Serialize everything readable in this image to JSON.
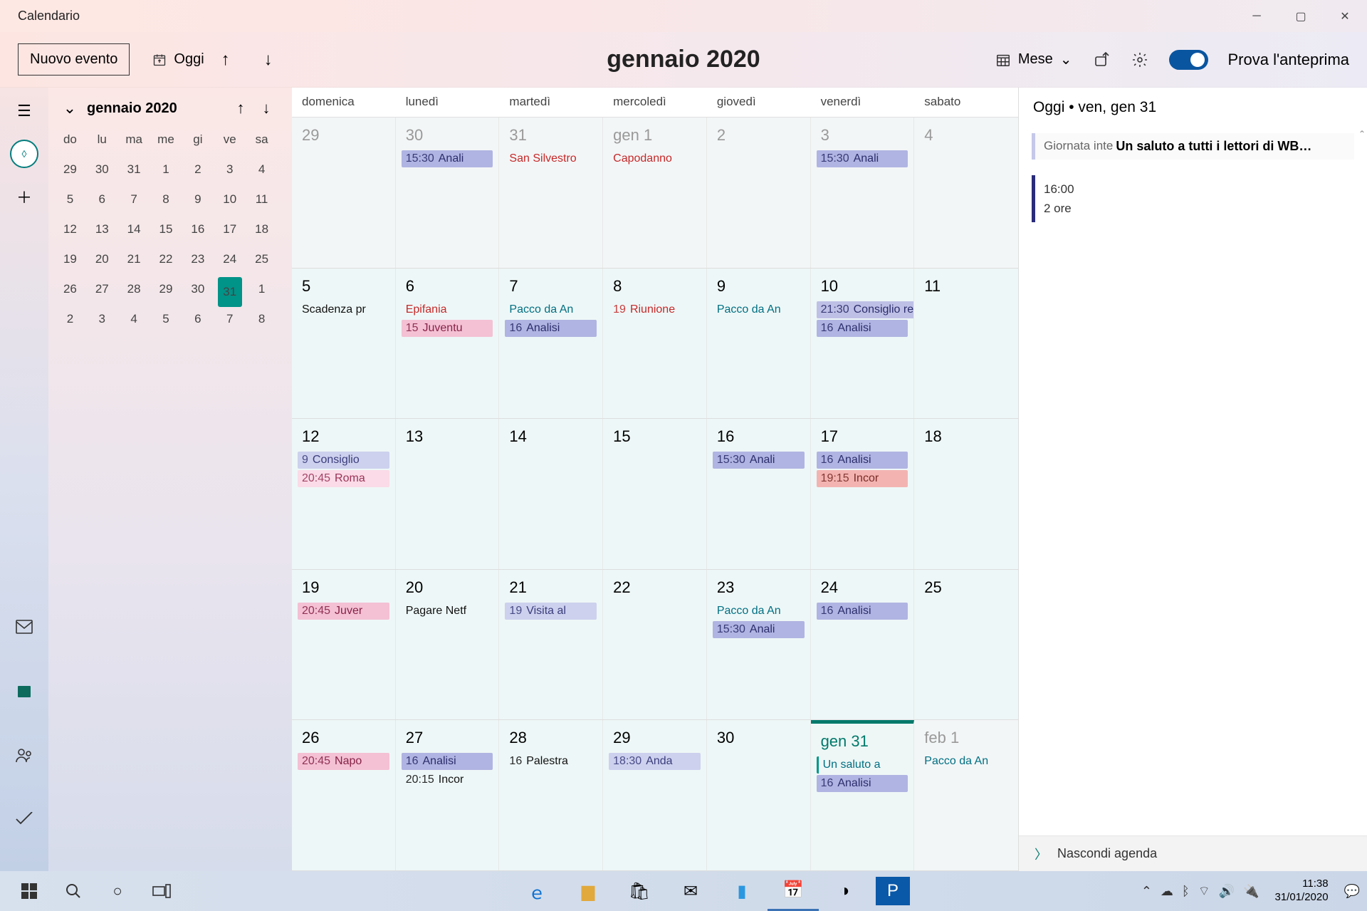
{
  "window": {
    "title": "Calendario"
  },
  "toolbar": {
    "newEvent": "Nuovo evento",
    "today": "Oggi",
    "centerTitle": "gennaio 2020",
    "viewLabel": "Mese",
    "preview": "Prova l'anteprima"
  },
  "miniCal": {
    "title": "gennaio 2020",
    "dows": [
      "do",
      "lu",
      "ma",
      "me",
      "gi",
      "ve",
      "sa"
    ],
    "cells": [
      {
        "d": "29",
        "o": true
      },
      {
        "d": "30",
        "o": true
      },
      {
        "d": "31",
        "o": true
      },
      {
        "d": "1"
      },
      {
        "d": "2"
      },
      {
        "d": "3"
      },
      {
        "d": "4"
      },
      {
        "d": "5"
      },
      {
        "d": "6"
      },
      {
        "d": "7"
      },
      {
        "d": "8"
      },
      {
        "d": "9"
      },
      {
        "d": "10"
      },
      {
        "d": "11"
      },
      {
        "d": "12"
      },
      {
        "d": "13"
      },
      {
        "d": "14"
      },
      {
        "d": "15"
      },
      {
        "d": "16"
      },
      {
        "d": "17"
      },
      {
        "d": "18"
      },
      {
        "d": "19"
      },
      {
        "d": "20"
      },
      {
        "d": "21"
      },
      {
        "d": "22"
      },
      {
        "d": "23"
      },
      {
        "d": "24"
      },
      {
        "d": "25"
      },
      {
        "d": "26"
      },
      {
        "d": "27"
      },
      {
        "d": "28"
      },
      {
        "d": "29"
      },
      {
        "d": "30"
      },
      {
        "d": "31",
        "today": true
      },
      {
        "d": "1",
        "o": true
      },
      {
        "d": "2",
        "o": true
      },
      {
        "d": "3",
        "o": true
      },
      {
        "d": "4",
        "o": true
      },
      {
        "d": "5",
        "o": true
      },
      {
        "d": "6",
        "o": true
      },
      {
        "d": "7",
        "o": true
      },
      {
        "d": "8",
        "o": true
      }
    ]
  },
  "dayNames": [
    "domenica",
    "lunedì",
    "martedì",
    "mercoledì",
    "giovedì",
    "venerdì",
    "sabato"
  ],
  "weeks": [
    [
      {
        "num": "29",
        "other": true
      },
      {
        "num": "30",
        "other": true,
        "events": [
          {
            "t": "15:30",
            "title": "Anali",
            "cls": "ev-purple"
          }
        ]
      },
      {
        "num": "31",
        "other": true,
        "events": [
          {
            "title": "San Silvestro",
            "cls": "ev-red-hol"
          }
        ]
      },
      {
        "num": "gen 1",
        "other": true,
        "events": [
          {
            "title": "Capodanno",
            "cls": "ev-red-hol"
          }
        ]
      },
      {
        "num": "2",
        "other": true
      },
      {
        "num": "3",
        "other": true,
        "events": [
          {
            "t": "15:30",
            "title": "Anali",
            "cls": "ev-purple"
          }
        ]
      },
      {
        "num": "4",
        "other": true
      }
    ],
    [
      {
        "num": "5",
        "events": [
          {
            "title": "Scadenza pr",
            "cls": "ev-dark"
          }
        ]
      },
      {
        "num": "6",
        "events": [
          {
            "title": "Epifania",
            "cls": "ev-red-hol"
          },
          {
            "t": "15",
            "title": "Juventu",
            "cls": "ev-pink"
          }
        ]
      },
      {
        "num": "7",
        "events": [
          {
            "title": "Pacco da An",
            "cls": "ev-teal"
          },
          {
            "t": "16",
            "title": "Analisi",
            "cls": "ev-purple"
          }
        ]
      },
      {
        "num": "8",
        "events": [
          {
            "t": "19",
            "title": "Riunione",
            "cls": "ev-red-hol"
          }
        ]
      },
      {
        "num": "9",
        "events": [
          {
            "title": "Pacco da An",
            "cls": "ev-teal"
          }
        ]
      },
      {
        "num": "10",
        "events": [
          {
            "t": "21:30",
            "title": "Consiglio regionale - |",
            "cls": "ev-council-wide",
            "wide": true
          },
          {
            "t": "16",
            "title": "Analisi",
            "cls": "ev-purple"
          }
        ]
      },
      {
        "num": "11"
      }
    ],
    [
      {
        "num": "12",
        "events": [
          {
            "t": "9",
            "title": "Consiglio",
            "cls": "ev-purple-light"
          },
          {
            "t": "20:45",
            "title": "Roma",
            "cls": "ev-pink-light"
          }
        ]
      },
      {
        "num": "13"
      },
      {
        "num": "14"
      },
      {
        "num": "15"
      },
      {
        "num": "16",
        "events": [
          {
            "t": "15:30",
            "title": "Anali",
            "cls": "ev-purple"
          }
        ]
      },
      {
        "num": "17",
        "events": [
          {
            "t": "16",
            "title": "Analisi",
            "cls": "ev-purple"
          },
          {
            "t": "19:15",
            "title": "Incor",
            "cls": "ev-coral"
          }
        ]
      },
      {
        "num": "18"
      }
    ],
    [
      {
        "num": "19",
        "events": [
          {
            "t": "20:45",
            "title": "Juver",
            "cls": "ev-pink"
          }
        ]
      },
      {
        "num": "20",
        "events": [
          {
            "title": "Pagare Netf",
            "cls": "ev-dark"
          }
        ]
      },
      {
        "num": "21",
        "events": [
          {
            "t": "19",
            "title": "Visita al",
            "cls": "ev-purple-light"
          }
        ]
      },
      {
        "num": "22"
      },
      {
        "num": "23",
        "events": [
          {
            "title": "Pacco da An",
            "cls": "ev-teal"
          },
          {
            "t": "15:30",
            "title": "Anali",
            "cls": "ev-purple"
          }
        ]
      },
      {
        "num": "24",
        "events": [
          {
            "t": "16",
            "title": "Analisi",
            "cls": "ev-purple"
          }
        ]
      },
      {
        "num": "25"
      }
    ],
    [
      {
        "num": "26",
        "events": [
          {
            "t": "20:45",
            "title": "Napo",
            "cls": "ev-pink"
          }
        ]
      },
      {
        "num": "27",
        "events": [
          {
            "t": "16",
            "title": "Analisi",
            "cls": "ev-purple"
          },
          {
            "t": "20:15",
            "title": "Incor",
            "cls": "ev-dark"
          }
        ]
      },
      {
        "num": "28",
        "events": [
          {
            "t": "16",
            "title": "Palestra",
            "cls": "ev-dark"
          }
        ]
      },
      {
        "num": "29",
        "events": [
          {
            "t": "18:30",
            "title": "Anda",
            "cls": "ev-purple-light"
          }
        ]
      },
      {
        "num": "30"
      },
      {
        "num": "gen 31",
        "today": true,
        "events": [
          {
            "title": "Un saluto a",
            "cls": "ev-teal ev-bar-teal"
          },
          {
            "t": "16",
            "title": "Analisi",
            "cls": "ev-purple"
          }
        ]
      },
      {
        "num": "feb 1",
        "other": true,
        "events": [
          {
            "title": "Pacco da An",
            "cls": "ev-teal"
          }
        ]
      }
    ]
  ],
  "agenda": {
    "header": "Oggi • ven, gen 31",
    "allDayLabel": "Giornata inte",
    "allDayTitle": "Un saluto a tutti i lettori di WB…",
    "item2Time": "16:00",
    "item2Dur": "2 ore",
    "hide": "Nascondi agenda"
  },
  "taskbar": {
    "time": "11:38",
    "date": "31/01/2020"
  }
}
